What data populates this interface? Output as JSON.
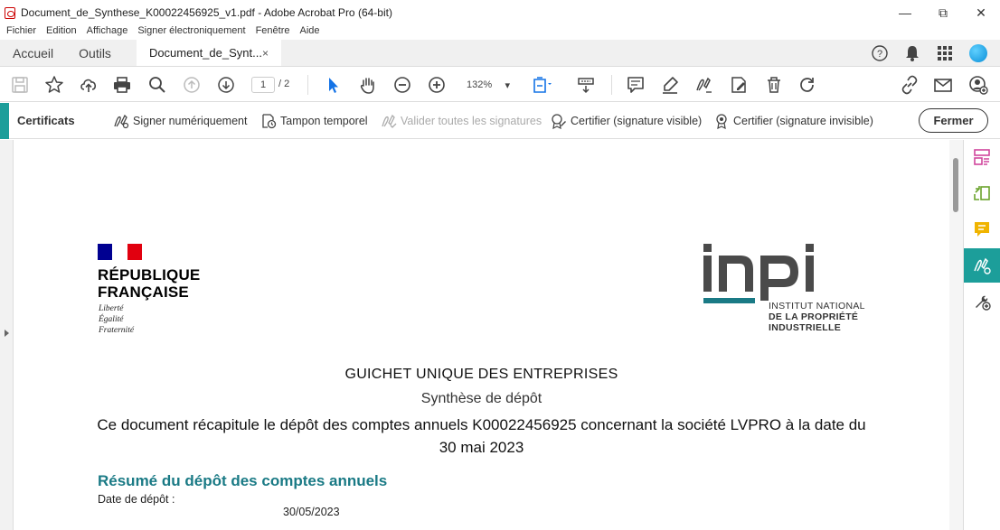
{
  "window": {
    "title": "Document_de_Synthese_K00022456925_v1.pdf - Adobe Acrobat Pro (64-bit)",
    "minimize": "—",
    "restore": "⧉",
    "close": "✕"
  },
  "menu": [
    "Fichier",
    "Edition",
    "Affichage",
    "Signer électroniquement",
    "Fenêtre",
    "Aide"
  ],
  "tabs": {
    "home": "Accueil",
    "tools": "Outils",
    "document": "Document_de_Synt...",
    "close": "×"
  },
  "toolbar": {
    "page_current": "1",
    "page_total": "/ 2",
    "zoom": "132%",
    "zoom_caret": "▾"
  },
  "certbar": {
    "label": "Certificats",
    "sign_digitally": "Signer numériquement",
    "timestamp": "Tampon temporel",
    "validate_all": "Valider toutes les signatures",
    "certify_visible": "Certifier (signature visible)",
    "certify_invisible": "Certifier (signature invisible)",
    "close": "Fermer"
  },
  "document": {
    "rf_title_line1": "RÉPUBLIQUE",
    "rf_title_line2": "FRANÇAISE",
    "rf_motto_1": "Liberté",
    "rf_motto_2": "Égalité",
    "rf_motto_3": "Fraternité",
    "inpi_logo": "inpi",
    "inpi_sub_1": "INSTITUT NATIONAL",
    "inpi_sub_2": "DE LA PROPRIÉTÉ",
    "inpi_sub_3": "INDUSTRIELLE",
    "heading": "GUICHET UNIQUE DES ENTREPRISES",
    "subheading": "Synthèse de dépôt",
    "description": "Ce document récapitule le dépôt des comptes annuels K00022456925 concernant la société LVPRO à la date du 30 mai 2023",
    "section_title": "Résumé du dépôt des comptes annuels",
    "deposit_date_label": "Date de dépôt :",
    "deposit_date_value": "30/05/2023"
  },
  "colors": {
    "accent": "#1c9e9a",
    "section_title": "#1a7a85",
    "toolbar_blue": "#1473e6",
    "inpi_gray": "#4a4a4a",
    "inpi_teal": "#1a7a85"
  },
  "icons": {
    "toolbar": [
      "save-icon",
      "star-icon",
      "cloud-upload-icon",
      "print-icon",
      "search-icon",
      "page-up-icon",
      "page-down-icon",
      "select-cursor-icon",
      "hand-icon",
      "zoom-out-icon",
      "zoom-in-icon",
      "fit-page-icon",
      "scroll-mode-icon",
      "comment-icon",
      "highlight-icon",
      "sign-icon",
      "edit-icon",
      "delete-icon",
      "rotate-icon",
      "link-icon",
      "mail-icon",
      "account-add-icon"
    ],
    "right_panel": [
      "organize-icon",
      "export-icon",
      "comment-icon",
      "certificate-icon",
      "tools-add-icon"
    ]
  }
}
